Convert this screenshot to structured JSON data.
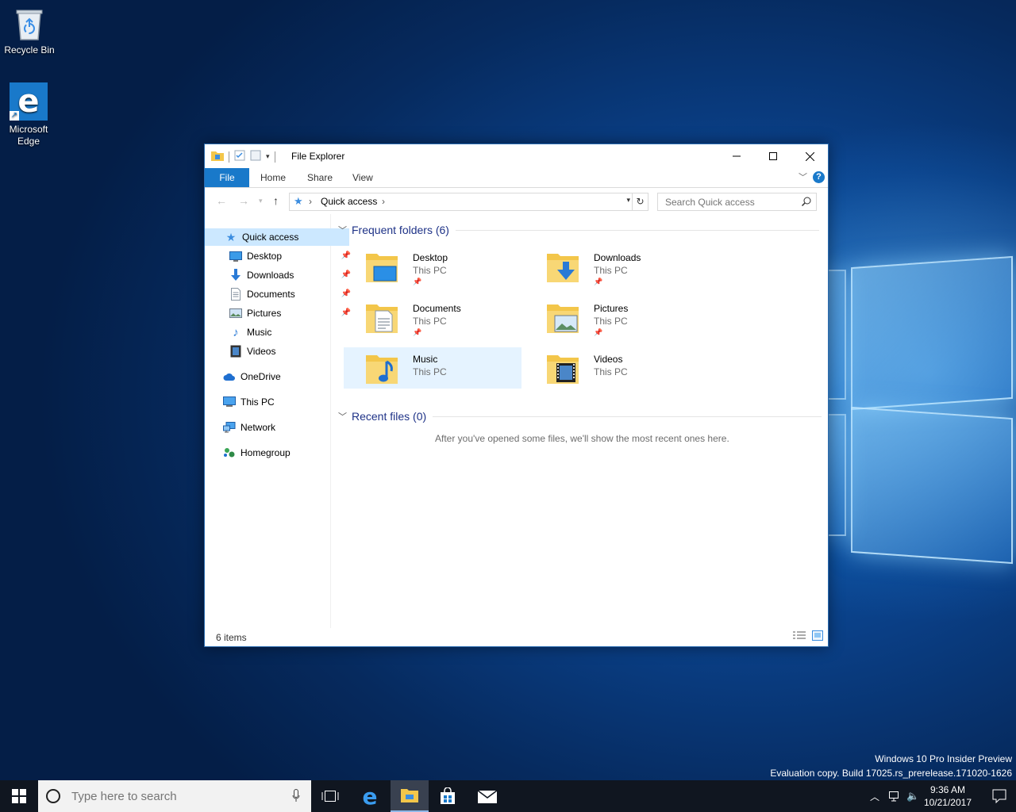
{
  "desktop": {
    "icons": [
      {
        "label": "Recycle Bin"
      },
      {
        "label": "Microsoft Edge"
      }
    ],
    "watermark": {
      "line1": "Windows 10 Pro Insider Preview",
      "line2": "Evaluation copy. Build 17025.rs_prerelease.171020-1626"
    }
  },
  "explorer": {
    "title": "File Explorer",
    "ribbon": {
      "tabs": [
        "File",
        "Home",
        "Share",
        "View"
      ],
      "help": "?"
    },
    "address": {
      "location": "Quick access",
      "separator": "›"
    },
    "search": {
      "placeholder": "Search Quick access"
    },
    "nav": {
      "quick_access": "Quick access",
      "pinned": [
        {
          "label": "Desktop",
          "pinned": true
        },
        {
          "label": "Downloads",
          "pinned": true
        },
        {
          "label": "Documents",
          "pinned": true
        },
        {
          "label": "Pictures",
          "pinned": true
        },
        {
          "label": "Music",
          "pinned": false
        },
        {
          "label": "Videos",
          "pinned": false
        }
      ],
      "onedrive": "OneDrive",
      "this_pc": "This PC",
      "network": "Network",
      "homegroup": "Homegroup"
    },
    "frequent": {
      "header": "Frequent folders (6)",
      "folders": [
        {
          "name": "Desktop",
          "location": "This PC",
          "pinned": true
        },
        {
          "name": "Downloads",
          "location": "This PC",
          "pinned": true
        },
        {
          "name": "Documents",
          "location": "This PC",
          "pinned": true
        },
        {
          "name": "Pictures",
          "location": "This PC",
          "pinned": true
        },
        {
          "name": "Music",
          "location": "This PC",
          "pinned": false
        },
        {
          "name": "Videos",
          "location": "This PC",
          "pinned": false
        }
      ]
    },
    "recent": {
      "header": "Recent files (0)",
      "empty_message": "After you've opened some files, we'll show the most recent ones here."
    },
    "status": {
      "item_count": "6 items"
    }
  },
  "taskbar": {
    "search_placeholder": "Type here to search",
    "time": "9:36 AM",
    "date": "10/21/2017"
  },
  "colors": {
    "accent": "#1979ca",
    "selection": "#cce8ff",
    "group_header": "#1e3287"
  }
}
